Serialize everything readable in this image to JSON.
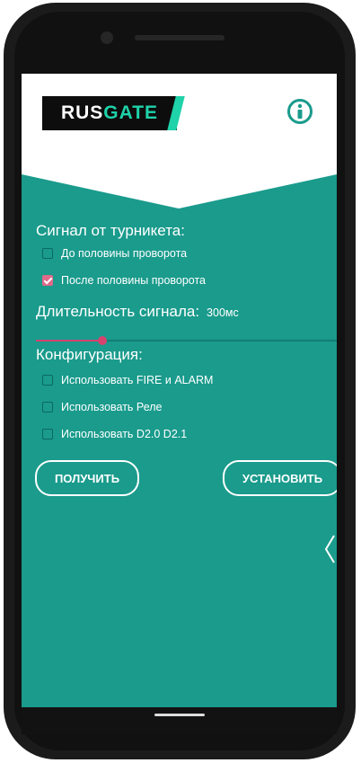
{
  "logo": {
    "rus": "RUS",
    "gate": "GATE"
  },
  "icons": {
    "info": "info-icon",
    "back": "chevron-left-icon"
  },
  "signal": {
    "title": "Сигнал от турникета:",
    "options": [
      {
        "label": "До половины проворота",
        "checked": false
      },
      {
        "label": "После половины проворота",
        "checked": true
      }
    ]
  },
  "duration": {
    "label": "Длительность сигнала:",
    "value": "300мс",
    "level": 0.22
  },
  "config": {
    "title": "Конфигурация:",
    "options": [
      {
        "label": "Использовать FIRE и  ALARM",
        "checked": false
      },
      {
        "label": "Использовать Реле",
        "checked": false
      },
      {
        "label": "Использовать D2.0  D2.1",
        "checked": false
      }
    ]
  },
  "buttons": {
    "get": "ПОЛУЧИТЬ",
    "set": "УСТАНОВИТЬ"
  },
  "colors": {
    "teal": "#1a9b8c",
    "accent": "#d7436f",
    "logo_green": "#1fd2a9"
  }
}
